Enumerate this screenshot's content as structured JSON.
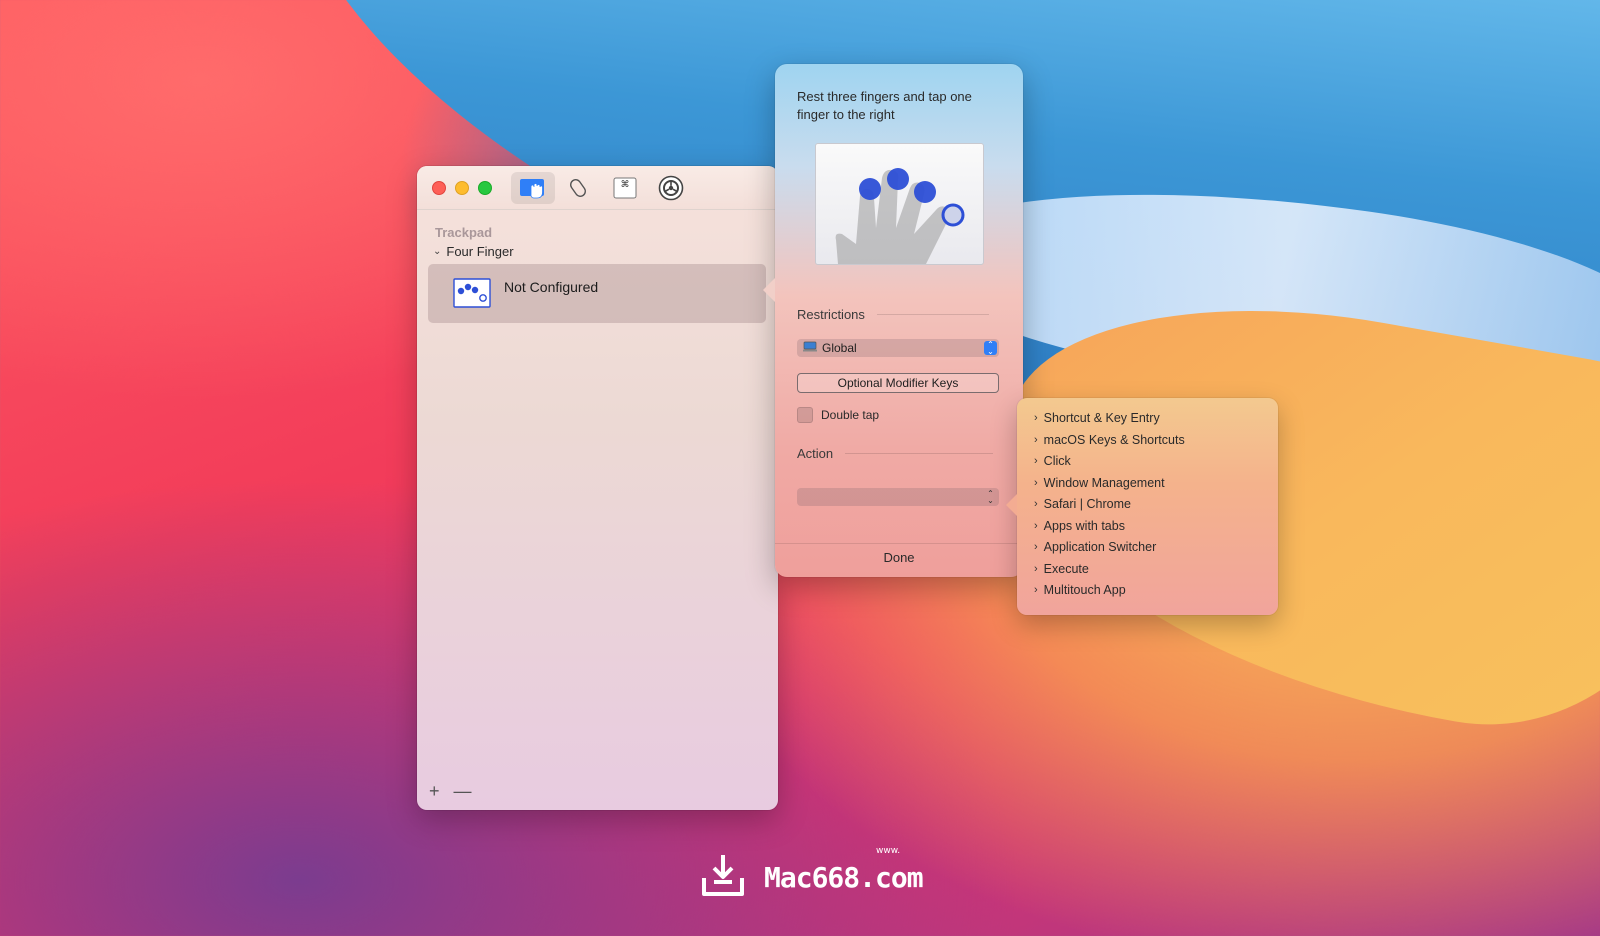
{
  "window": {
    "section_label": "Trackpad",
    "group_label": "Four Finger",
    "item_label": "Not Configured",
    "add_button": "+",
    "remove_button": "—"
  },
  "popover": {
    "description": "Rest three fingers and tap one finger to the right",
    "restrictions_label": "Restrictions",
    "restriction_value": "Global",
    "modifier_button": "Optional Modifier Keys",
    "double_tap_label": "Double tap",
    "action_label": "Action",
    "action_value": "",
    "done_label": "Done"
  },
  "menu": {
    "items": [
      "Shortcut & Key Entry",
      "macOS Keys & Shortcuts",
      "Click",
      "Window Management",
      "Safari | Chrome",
      "Apps with tabs",
      "Application Switcher",
      "Execute",
      "Multitouch App"
    ]
  },
  "watermark": {
    "text": "Mac668.com",
    "small": "www."
  },
  "icons": [
    "trackpad-hand-icon",
    "magic-mouse-icon",
    "keyboard-command-icon",
    "settings-gear-icon",
    "download-tray-icon"
  ],
  "colors": {
    "accent": "#2f7ff7",
    "finger_dots": "#2d4fd6"
  }
}
